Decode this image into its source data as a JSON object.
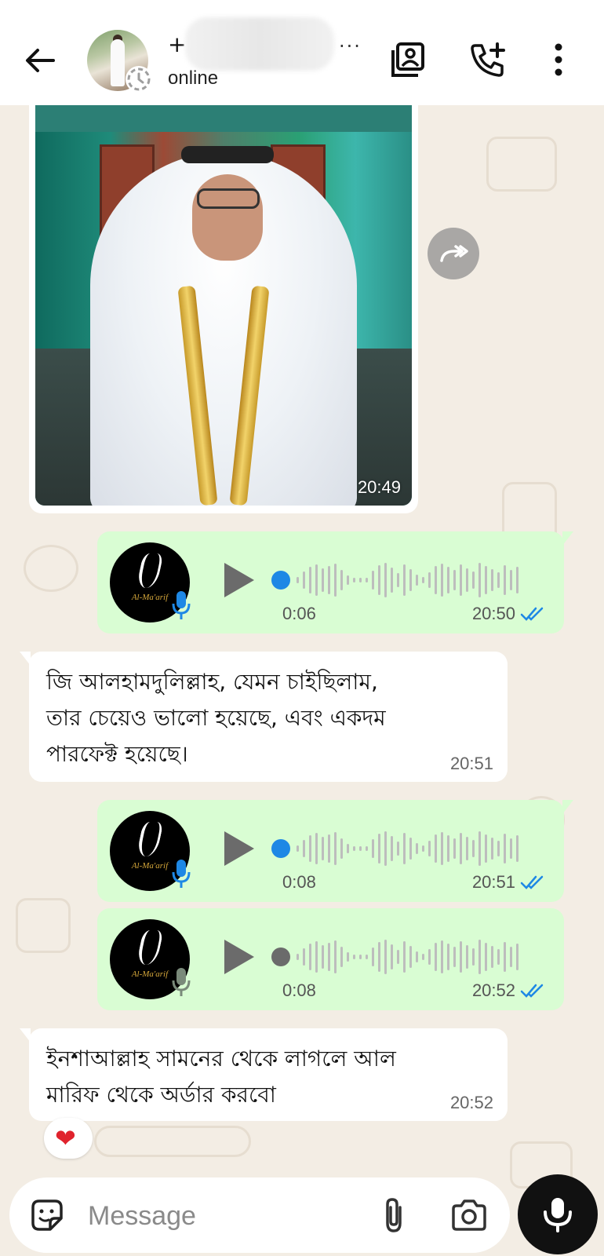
{
  "header": {
    "contact_name_prefix": "+",
    "contact_name_suffix": "...",
    "status": "online",
    "icons": [
      "back-arrow-icon",
      "gallery-icon",
      "add-call-icon",
      "more-vert-icon"
    ]
  },
  "messages": {
    "image": {
      "time": "20:49"
    },
    "voice1": {
      "duration": "0:06",
      "time": "20:50",
      "played": false,
      "sender_label": "Al-Ma'arif"
    },
    "text1": {
      "text": "জি আলহামদুলিল্লাহ, যেমন চাইছিলাম,\nতার চেয়েও  ভালো হয়েছে, এবং একদম\nপারফেক্ট হয়েছে।",
      "time": "20:51"
    },
    "voice2": {
      "duration": "0:08",
      "time": "20:51",
      "played": false,
      "sender_label": "Al-Ma'arif"
    },
    "voice3": {
      "duration": "0:08",
      "time": "20:52",
      "played": true,
      "sender_label": "Al-Ma'arif"
    },
    "text2": {
      "text": "ইনশাআল্লাহ সামনের থেকে লাগলে আল\nমারিফ থেকে অর্ডার করবো",
      "time": "20:52",
      "reaction": "❤"
    }
  },
  "composer": {
    "placeholder": "Message"
  },
  "colors": {
    "outgoing_bubble": "#d9fdd3",
    "incoming_bubble": "#ffffff",
    "wallpaper": "#f3ede4",
    "unplayed_dot": "#1e88e5",
    "played_dot": "#6b6b6b",
    "read_ticks": "#1e88e5",
    "mic_fab": "#111111"
  }
}
